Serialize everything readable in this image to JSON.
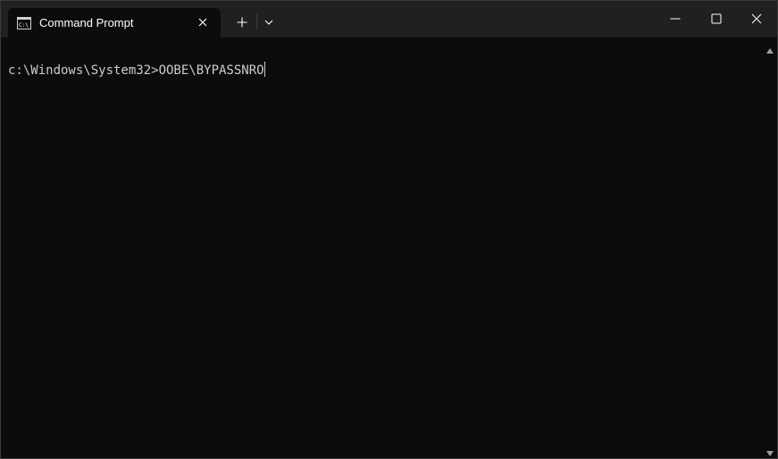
{
  "window": {
    "tab_title": "Command Prompt",
    "icons": {
      "tab": "cmd-icon",
      "tab_close": "close-icon",
      "new_tab": "plus-icon",
      "dropdown": "chevron-down-icon",
      "minimize": "minimize-icon",
      "maximize": "maximize-icon",
      "close": "close-icon"
    }
  },
  "terminal": {
    "prompt": "c:\\Windows\\System32>",
    "input": "OOBE\\BYPASSNRO"
  },
  "colors": {
    "titlebar": "#202020",
    "terminal_bg": "#0c0c0c",
    "text": "#cccccc"
  }
}
